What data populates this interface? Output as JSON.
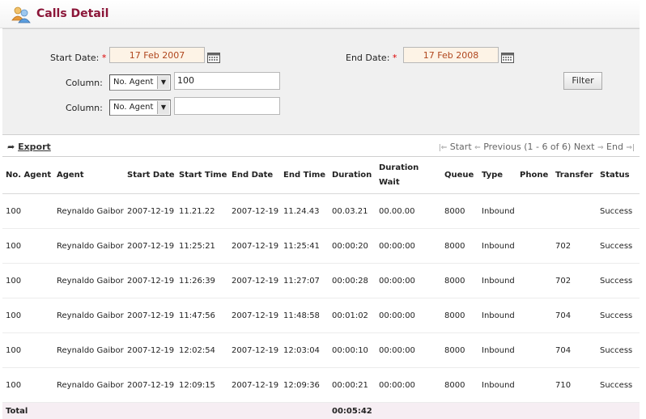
{
  "page": {
    "title": "Calls Detail"
  },
  "filters": {
    "start_date_label": "Start Date:",
    "end_date_label": "End Date:",
    "required_mark": "*",
    "start_date": "17 Feb 2007",
    "end_date": "17 Feb 2008",
    "column_label_1": "Column:",
    "column_label_2": "Column:",
    "column_select_1": "No. Agent",
    "column_value_1": "100",
    "column_select_2": "No. Agent",
    "column_value_2": "",
    "filter_button": "Filter"
  },
  "toolbar": {
    "export_label": "Export",
    "start": "Start",
    "previous": "Previous",
    "range": "(1 - 6 of 6)",
    "next": "Next",
    "end": "End"
  },
  "table": {
    "headers": [
      "No. Agent",
      "Agent",
      "Start Date",
      "Start Time",
      "End Date",
      "End Time",
      "Duration",
      "Duration Wait",
      "Queue",
      "Type",
      "Phone",
      "Transfer",
      "Status"
    ],
    "rows": [
      [
        "100",
        "Reynaldo Gaibor",
        "2007-12-19",
        "11.21.22",
        "2007-12-19",
        "11.24.43",
        "00.03.21",
        "00.00.00",
        "8000",
        "Inbound",
        "",
        "",
        "Success"
      ],
      [
        "100",
        "Reynaldo Gaibor",
        "2007-12-19",
        "11:25:21",
        "2007-12-19",
        "11:25:41",
        "00:00:20",
        "00:00:00",
        "8000",
        "Inbound",
        "",
        "702",
        "Success"
      ],
      [
        "100",
        "Reynaldo Gaibor",
        "2007-12-19",
        "11:26:39",
        "2007-12-19",
        "11:27:07",
        "00:00:28",
        "00:00:00",
        "8000",
        "Inbound",
        "",
        "702",
        "Success"
      ],
      [
        "100",
        "Reynaldo Gaibor",
        "2007-12-19",
        "11:47:56",
        "2007-12-19",
        "11:48:58",
        "00:01:02",
        "00:00:00",
        "8000",
        "Inbound",
        "",
        "704",
        "Success"
      ],
      [
        "100",
        "Reynaldo Gaibor",
        "2007-12-19",
        "12:02:54",
        "2007-12-19",
        "12:03:04",
        "00:00:10",
        "00:00:00",
        "8000",
        "Inbound",
        "",
        "704",
        "Success"
      ],
      [
        "100",
        "Reynaldo Gaibor",
        "2007-12-19",
        "12:09:15",
        "2007-12-19",
        "12:09:36",
        "00:00:21",
        "00:00:00",
        "8000",
        "Inbound",
        "",
        "710",
        "Success"
      ]
    ],
    "total_label": "Total",
    "total_duration": "00:05:42"
  },
  "icons": {
    "logo": "users-icon",
    "calendar": "calendar-icon",
    "export": "export-arrow-icon"
  },
  "colors": {
    "title": "#8b1538",
    "date_text": "#b0461d",
    "date_bg": "#fdf3e6",
    "total_bg": "#f6eef3"
  }
}
